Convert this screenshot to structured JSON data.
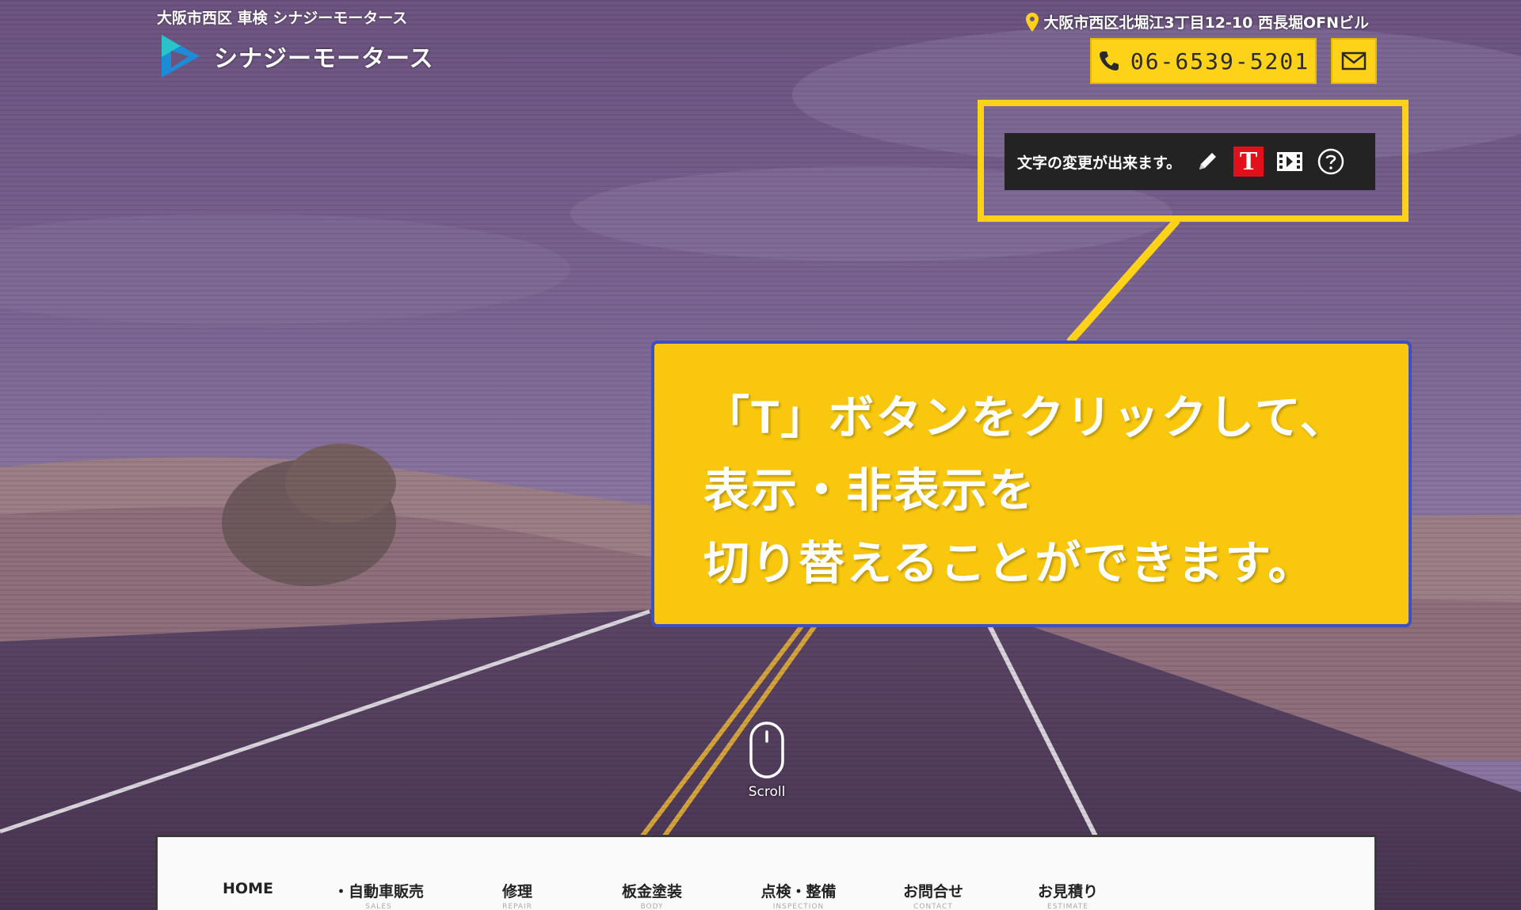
{
  "header": {
    "tagline": "大阪市西区 車検 シナジーモータース",
    "logo_text": "シナジーモータース",
    "address": "大阪市西区北堀江3丁目12-10 西長堀OFNビル",
    "phone": "06-6539-5201"
  },
  "edit_toolbar": {
    "message": "文字の変更が出来ます。",
    "text_toggle_glyph": "T"
  },
  "callout": {
    "lines": [
      "「T」ボタンをクリックして、",
      "表示・非表示を",
      "切り替えることができます。"
    ]
  },
  "scroll": {
    "label": "Scroll"
  },
  "nav": {
    "items": [
      {
        "label": "HOME",
        "sub": ""
      },
      {
        "label": "・自動車販売",
        "sub": "SALES"
      },
      {
        "label": "修理",
        "sub": "REPAIR"
      },
      {
        "label": "板金塗装",
        "sub": "BODY"
      },
      {
        "label": "点検・整備",
        "sub": "INSPECTION"
      },
      {
        "label": "お問合せ",
        "sub": "CONTACT"
      },
      {
        "label": "お見積り",
        "sub": "ESTIMATE"
      }
    ]
  },
  "colors": {
    "accent_yellow": "#ffd21a",
    "callout_yellow": "#f9c80e",
    "toggle_red": "#e3101c",
    "toolbar_bg": "#232323"
  }
}
